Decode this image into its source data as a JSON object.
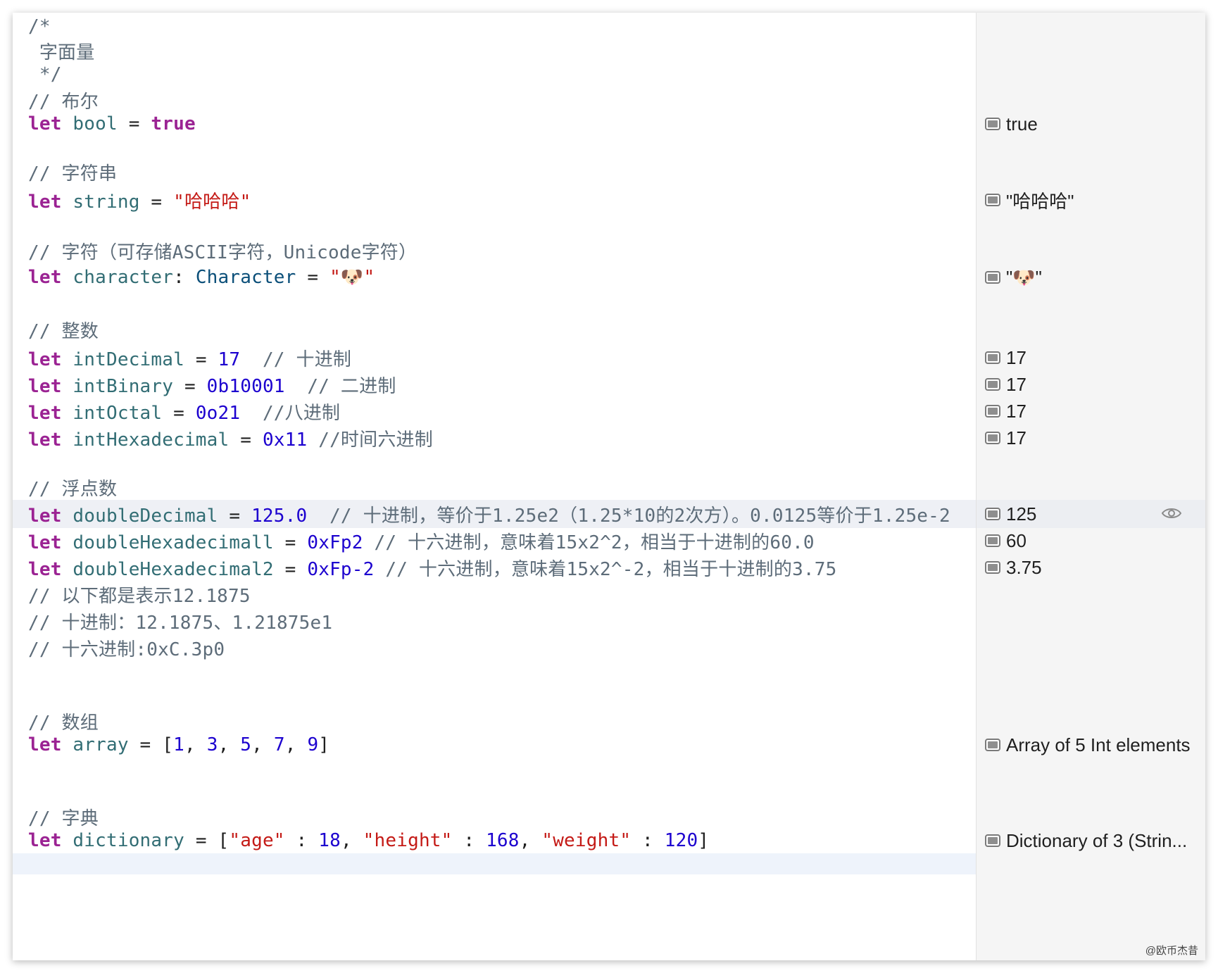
{
  "code_lines": [
    {
      "comment": "/*"
    },
    {
      "comment": " 字面量"
    },
    {
      "comment": " */"
    },
    {
      "comment": "// 布尔"
    },
    {
      "kw": "let",
      "name": "bool",
      "op": " = ",
      "value_kw": "true"
    },
    {
      "comment": "// 字符串"
    },
    {
      "kw": "let",
      "name": "string",
      "op": " = ",
      "value_str": "\"哈哈哈\""
    },
    {
      "comment": "// 字符（可存储ASCII字符，Unicode字符）"
    },
    {
      "kw": "let",
      "name": "character",
      "colon": ": ",
      "type": "Character",
      "op": " = ",
      "value_str": "\"🐶\""
    },
    {
      "comment": "// 整数"
    },
    {
      "kw": "let",
      "name": "intDecimal",
      "op": " = ",
      "value_num": "17",
      "trail": "  // 十进制"
    },
    {
      "kw": "let",
      "name": "intBinary",
      "op": " = ",
      "value_num": "0b10001",
      "trail": "  // 二进制"
    },
    {
      "kw": "let",
      "name": "intOctal",
      "op": " = ",
      "value_num": "0o21",
      "trail": "  //八进制"
    },
    {
      "kw": "let",
      "name": "intHexadecimal",
      "op": " = ",
      "value_num": "0x11",
      "trail": " //时间六进制"
    },
    {
      "comment": "// 浮点数"
    },
    {
      "kw": "let",
      "name": "doubleDecimal",
      "op": " = ",
      "value_num": "125.0",
      "trail": "  // 十进制，等价于1.25e2（1.25*10的2次方）。0.0125等价于1.25e-2"
    },
    {
      "kw": "let",
      "name": "doubleHexadecimall",
      "op": " = ",
      "value_num": "0xFp2",
      "trail": " // 十六进制，意味着15x2^2，相当于十进制的60.0"
    },
    {
      "kw": "let",
      "name": "doubleHexadecimal2",
      "op": " = ",
      "value_num": "0xFp-2",
      "trail": " // 十六进制，意味着15x2^-2，相当于十进制的3.75"
    },
    {
      "comment": "// 以下都是表示12.1875"
    },
    {
      "comment": "// 十进制：12.1875、1.21875e1"
    },
    {
      "comment": "// 十六进制:0xC.3p0"
    },
    {
      "comment": "// 数组"
    },
    {
      "kw": "let",
      "name": "array",
      "op": " = ",
      "array_open": "[",
      "array_items": [
        "1",
        "3",
        "5",
        "7",
        "9"
      ],
      "array_close": "]"
    },
    {
      "comment": "// 字典"
    },
    {
      "kw": "let",
      "name": "dictionary",
      "op": " = ",
      "dict_open": "[",
      "dict_items": [
        {
          "key": "\"age\"",
          "value": "18"
        },
        {
          "key": "\"height\"",
          "value": "168"
        },
        {
          "key": "\"weight\"",
          "value": "120"
        }
      ],
      "dict_close": "]"
    }
  ],
  "results": [
    {
      "line_index": 4,
      "text": "true"
    },
    {
      "line_index": 6,
      "text": "\"哈哈哈\""
    },
    {
      "line_index": 8,
      "text": "\"🐶\""
    },
    {
      "line_index": 10,
      "text": "17"
    },
    {
      "line_index": 11,
      "text": "17"
    },
    {
      "line_index": 12,
      "text": "17"
    },
    {
      "line_index": 13,
      "text": "17"
    },
    {
      "line_index": 15,
      "text": "125",
      "eye": true
    },
    {
      "line_index": 16,
      "text": "60"
    },
    {
      "line_index": 17,
      "text": "3.75"
    },
    {
      "line_index": 22,
      "text": "Array of 5 Int elements"
    },
    {
      "line_index": 24,
      "text": "Dictionary of 3 (Strin..."
    }
  ],
  "highlight_line_index": 15,
  "watermark": "@欧币杰昔",
  "icons": {
    "result_toggle": "result-view-icon",
    "quick_look": "eye-icon"
  },
  "colors": {
    "keyword": "#9b2393",
    "identifier": "#326d74",
    "number": "#1c00cf",
    "string": "#c41a16",
    "comment": "#5d6c79"
  }
}
